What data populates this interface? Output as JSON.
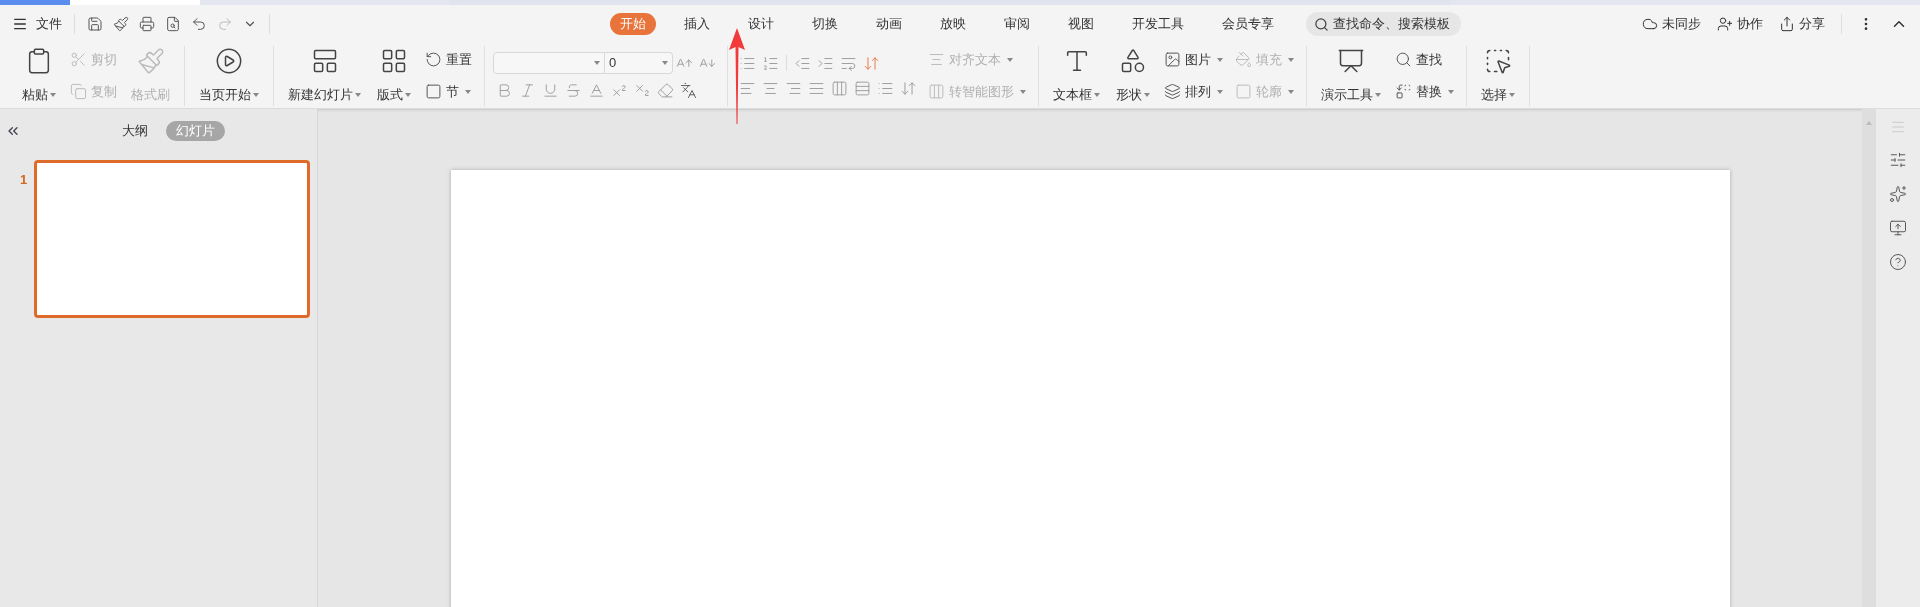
{
  "menu": {
    "file_label": "文件"
  },
  "tabs": [
    {
      "label": "开始",
      "selected": true
    },
    {
      "label": "插入",
      "selected": false
    },
    {
      "label": "设计",
      "selected": false
    },
    {
      "label": "切换",
      "selected": false
    },
    {
      "label": "动画",
      "selected": false
    },
    {
      "label": "放映",
      "selected": false
    },
    {
      "label": "审阅",
      "selected": false
    },
    {
      "label": "视图",
      "selected": false
    },
    {
      "label": "开发工具",
      "selected": false
    },
    {
      "label": "会员专享",
      "selected": false
    }
  ],
  "search": {
    "placeholder": "查找命令、搜索模板"
  },
  "header_actions": [
    {
      "label": "未同步"
    },
    {
      "label": "协作"
    },
    {
      "label": "分享"
    }
  ],
  "ribbon": [
    {
      "items": [
        {
          "kind": "large",
          "label": "粘贴",
          "dropdown": true,
          "disabled": false
        },
        {
          "kind": "stack",
          "items": [
            {
              "label": "剪切",
              "dropdown": false,
              "disabled": true
            },
            {
              "label": "复制",
              "dropdown": false,
              "disabled": true
            }
          ]
        },
        {
          "kind": "large",
          "label": "格式刷",
          "dropdown": false,
          "disabled": true
        }
      ]
    },
    {
      "items": [
        {
          "kind": "large",
          "label": "当页开始",
          "dropdown": true,
          "disabled": false
        }
      ]
    },
    {
      "items": [
        {
          "kind": "large",
          "label": "新建幻灯片",
          "dropdown": true,
          "disabled": false
        },
        {
          "kind": "large",
          "label": "版式",
          "dropdown": true,
          "disabled": false
        },
        {
          "kind": "stack",
          "items": [
            {
              "label": "重置",
              "dropdown": false,
              "disabled": false
            },
            {
              "label": "节",
              "dropdown": true,
              "disabled": false
            }
          ]
        }
      ]
    },
    {
      "items": [
        {
          "kind": "font",
          "size_value": "0"
        }
      ]
    },
    {
      "items": [
        {
          "kind": "paragraph"
        },
        {
          "kind": "stack",
          "items": [
            {
              "label": "对齐文本",
              "dropdown": true,
              "disabled": true
            },
            {
              "label": "转智能图形",
              "dropdown": true,
              "disabled": true
            }
          ]
        }
      ]
    },
    {
      "items": [
        {
          "kind": "large",
          "label": "文本框",
          "dropdown": true,
          "disabled": false
        },
        {
          "kind": "large",
          "label": "形状",
          "dropdown": true,
          "disabled": false
        },
        {
          "kind": "stack",
          "items": [
            {
              "label": "图片",
              "dropdown": true,
              "disabled": false
            },
            {
              "label": "排列",
              "dropdown": true,
              "disabled": false
            }
          ]
        },
        {
          "kind": "stack",
          "items": [
            {
              "label": "填充",
              "dropdown": true,
              "disabled": true
            },
            {
              "label": "轮廓",
              "dropdown": true,
              "disabled": true
            }
          ]
        }
      ]
    },
    {
      "items": [
        {
          "kind": "large",
          "label": "演示工具",
          "dropdown": true,
          "disabled": false
        },
        {
          "kind": "stack",
          "items": [
            {
              "label": "查找",
              "dropdown": false,
              "disabled": false
            },
            {
              "label": "替换",
              "dropdown": true,
              "disabled": false
            }
          ]
        }
      ]
    },
    {
      "items": [
        {
          "kind": "large",
          "label": "选择",
          "dropdown": true,
          "disabled": false
        }
      ]
    }
  ],
  "panel_tabs": [
    {
      "label": "大纲",
      "selected": false
    },
    {
      "label": "幻灯片",
      "selected": true
    }
  ],
  "slides": [
    {
      "number": "1",
      "selected": true
    }
  ]
}
